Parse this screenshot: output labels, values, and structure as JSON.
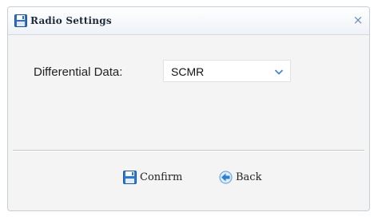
{
  "dialog": {
    "title": "Radio Settings",
    "title_icon": "floppy-disk-icon",
    "close_label": "×"
  },
  "form": {
    "differential_label": "Differential Data:",
    "differential_value": "SCMR",
    "dropdown_icon": "chevron-down-icon"
  },
  "buttons": {
    "confirm_label": "Confirm",
    "confirm_icon": "floppy-disk-icon",
    "back_label": "Back",
    "back_icon": "back-arrow-icon"
  },
  "colors": {
    "title_bar_bg": "#f5f7fa",
    "accent_blue": "#3b78c4",
    "close_icon": "#6a8cb8",
    "panel_bg": "#f4f4f4"
  }
}
